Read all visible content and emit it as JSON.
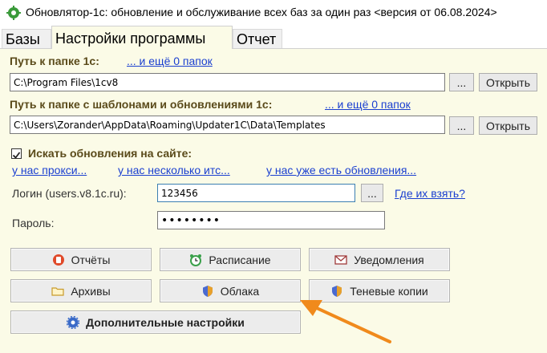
{
  "window": {
    "title": "Обновлятор-1с: обновление и обслуживание всех баз за один раз <версия от 06.08.2024>"
  },
  "tabs": [
    {
      "label": "Базы"
    },
    {
      "label": "Настройки программы"
    },
    {
      "label": "Отчет"
    }
  ],
  "settings": {
    "path1c": {
      "label": "Путь к папке 1с:",
      "more_link": "... и ещё 0 папок",
      "value": "C:\\Program Files\\1cv8",
      "browse_label": "...",
      "open_label": "Открыть"
    },
    "templates": {
      "label": "Путь к папке с шаблонами и обновлениями 1с:",
      "more_link": "... и ещё 0 папок",
      "value": "C:\\Users\\Zorander\\AppData\\Roaming\\Updater1C\\Data\\Templates",
      "browse_label": "...",
      "open_label": "Открыть"
    },
    "search_updates": {
      "label": "Искать обновления на сайте:",
      "checked": true,
      "links": [
        "у нас прокси...",
        "у нас несколько итс...",
        "у нас уже есть обновления..."
      ]
    },
    "login": {
      "label": "Логин (users.v8.1c.ru):",
      "value": "123456",
      "browse_label": "...",
      "where_link": "Где их взять?"
    },
    "password": {
      "label": "Пароль:",
      "value": "••••••••"
    }
  },
  "buttons": {
    "reports": "Отчёты",
    "schedule": "Расписание",
    "notifications": "Уведомления",
    "archives": "Архивы",
    "clouds": "Облака",
    "shadow_copies": "Теневые копии",
    "advanced": "Дополнительные настройки"
  },
  "colors": {
    "panel_bg": "#fbfbe7",
    "label_brown": "#5a4a1a",
    "link_blue": "#1a3fd0",
    "annotation_arrow": "#f08a1c"
  },
  "icons": {
    "app": "gear-update-icon",
    "reports": "red-stop-icon",
    "schedule": "alarm-clock-icon",
    "notifications": "envelope-icon",
    "archives": "folder-icon",
    "clouds": "shield-icon",
    "shadow_copies": "shield-icon",
    "advanced": "gear-icon"
  }
}
